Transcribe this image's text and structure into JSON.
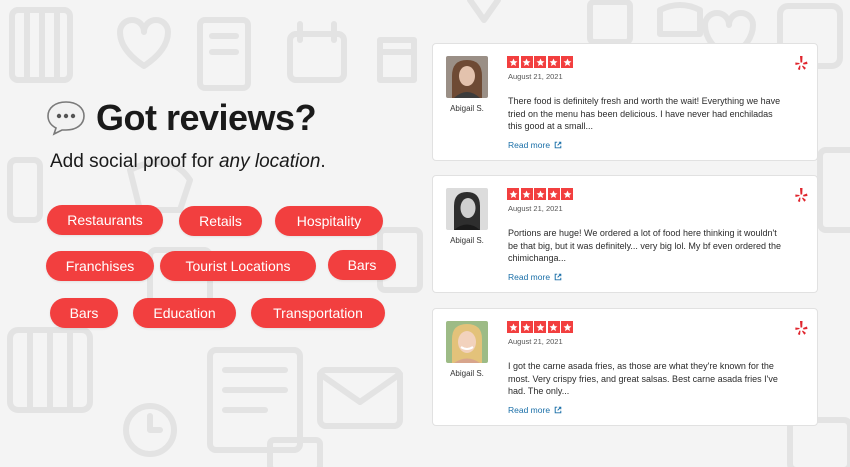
{
  "headline": {
    "emoji_icon": "speech-bubble-icon",
    "title": "Got reviews?",
    "subtitle_prefix": "Add social proof for ",
    "subtitle_emphasis": "any location",
    "subtitle_suffix": "."
  },
  "tags": [
    {
      "label": "Restaurants"
    },
    {
      "label": "Retails"
    },
    {
      "label": "Hospitality"
    },
    {
      "label": "Franchises"
    },
    {
      "label": "Tourist Locations"
    },
    {
      "label": "Bars"
    },
    {
      "label": "Bars"
    },
    {
      "label": "Education"
    },
    {
      "label": "Transportation"
    }
  ],
  "reviews": [
    {
      "name": "Abigail S.",
      "date": "August 21, 2021",
      "rating": 5,
      "text": "There food is definitely fresh and worth the wait! Everything we have tried on the menu has been delicious. I have never had enchiladas this good at a small...",
      "read_more": "Read more"
    },
    {
      "name": "Abigail S.",
      "date": "August 21, 2021",
      "rating": 5,
      "text": "Portions are huge! We ordered a lot of food here thinking it wouldn't be that big, but it was definitely... very big lol. My bf even ordered the chimichanga...",
      "read_more": "Read more"
    },
    {
      "name": "Abigail S.",
      "date": "August 21, 2021",
      "rating": 5,
      "text": "I got the carne asada fries, as those are what they're known for the most. Very crispy fries, and great salsas. Best carne asada fries I've had. The only...",
      "read_more": "Read more"
    }
  ],
  "colors": {
    "accent": "#f23f3f",
    "link": "#1a6fa8",
    "background": "#f4f4f4",
    "card": "#ffffff"
  },
  "icons": {
    "rating": "star-icon",
    "source": "yelp-logo-icon",
    "link": "external-link-icon"
  }
}
